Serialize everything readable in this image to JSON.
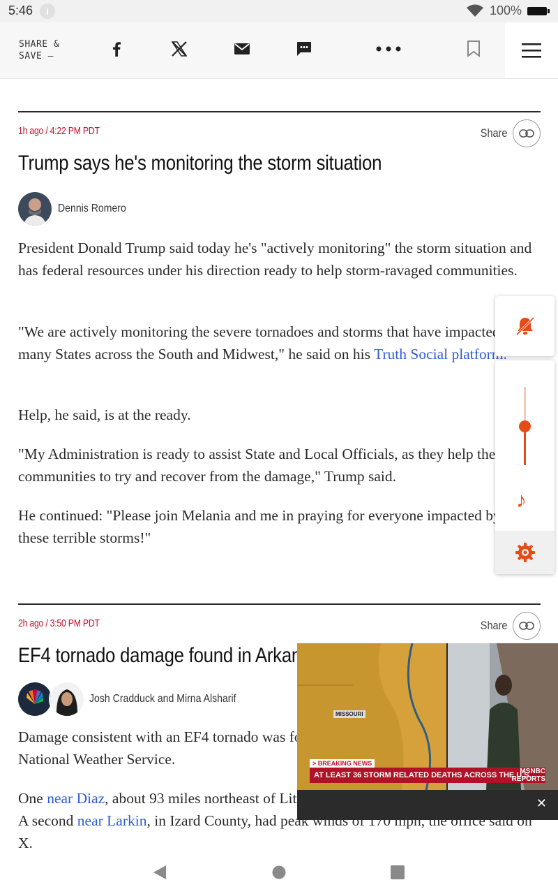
{
  "status_bar": {
    "time": "5:46",
    "battery": "100%"
  },
  "share_bar": {
    "label_line1": "SHARE &",
    "label_line2": "SAVE —",
    "icons": [
      "facebook-icon",
      "x-icon",
      "email-icon",
      "sms-icon",
      "more-icon",
      "bookmark-icon",
      "menu-icon"
    ]
  },
  "post1": {
    "timestamp": "1h ago / 4:22 PM PDT",
    "share_label": "Share",
    "headline": "Trump says he's monitoring the storm situation",
    "author": "Dennis Romero",
    "p1": "President Donald Trump said today he's \"actively monitoring\" the storm situation and has federal resources under his direction ready to help storm-ravaged communities.",
    "p2_text": "\"We are actively monitoring the severe tornadoes and storms that have impacted many States across the South and Midwest,\" he said on his ",
    "p2_link": "Truth Social platform.",
    "p3": "Help, he said, is at the ready.",
    "p4": "\"My Administration is ready to assist State and Local Officials, as they help their communities to try and recover from the damage,\" Trump said.",
    "p5": "He continued: \"Please join Melania and me in praying for everyone impacted by these terrible storms!\""
  },
  "post2": {
    "timestamp": "2h ago / 3:50 PM PDT",
    "share_label": "Share",
    "headline": "EF4 tornado damage found in Arkansas",
    "author1": "Josh Cradduck",
    "and": "and",
    "author2": "Mirna Alsharif",
    "p1": "Damage consistent with an EF4 tornado was found in Arkansas, according to the National Weather Service.",
    "p2_a": "One ",
    "p2_link1": "near Diaz",
    "p2_b": ", about 93 miles northeast of Little Rock, had peak winds of 190 mph. A second ",
    "p2_link2": "near Larkin",
    "p2_c": ", in Izard County, had peak winds of 170 mph, the office said on X."
  },
  "video": {
    "map_label": "MISSOURI",
    "breaking_label": "> BREAKING NEWS",
    "ticker": "AT LEAST 36 STORM RELATED DEATHS ACROSS THE U.S.",
    "brand_line1": "MSNBC",
    "brand_line2": "REPORTS",
    "close": "✕"
  },
  "accent_color": "#e54b17",
  "link_color": "#2f5bd8",
  "stamp_color": "#c8102e",
  "audio_widget": {
    "volume_level": 0.5
  }
}
